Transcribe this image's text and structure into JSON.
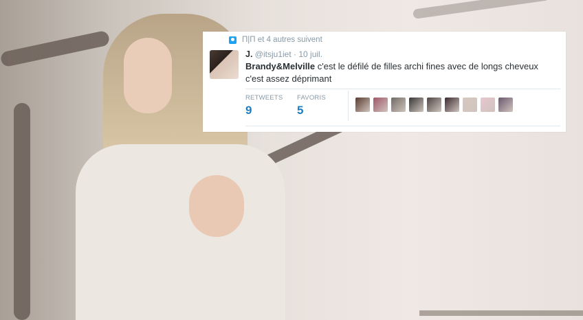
{
  "tweet": {
    "context_text": "Π|Π et 4 autres suivent",
    "context_icon": "person-icon",
    "author_name": "J.",
    "author_handle": "@itsju1iet",
    "separator": "·",
    "date": "10 juil.",
    "text_bold": "Brandy&Melville",
    "text_rest": " c'est le défilé de filles archi fines avec de longs cheveux c'est assez déprimant",
    "retweets_label": "RETWEETS",
    "retweets_value": "9",
    "favorites_label": "FAVORIS",
    "favorites_value": "5",
    "accent_color": "#1d7dbf",
    "favoriter_avatar_colors": [
      "#5a3b2e",
      "#a05668",
      "#706a64",
      "#3a3736",
      "#4d4544",
      "#3b2a2f",
      "#d7c8c0",
      "#e8c6cf",
      "#6b5870"
    ]
  }
}
